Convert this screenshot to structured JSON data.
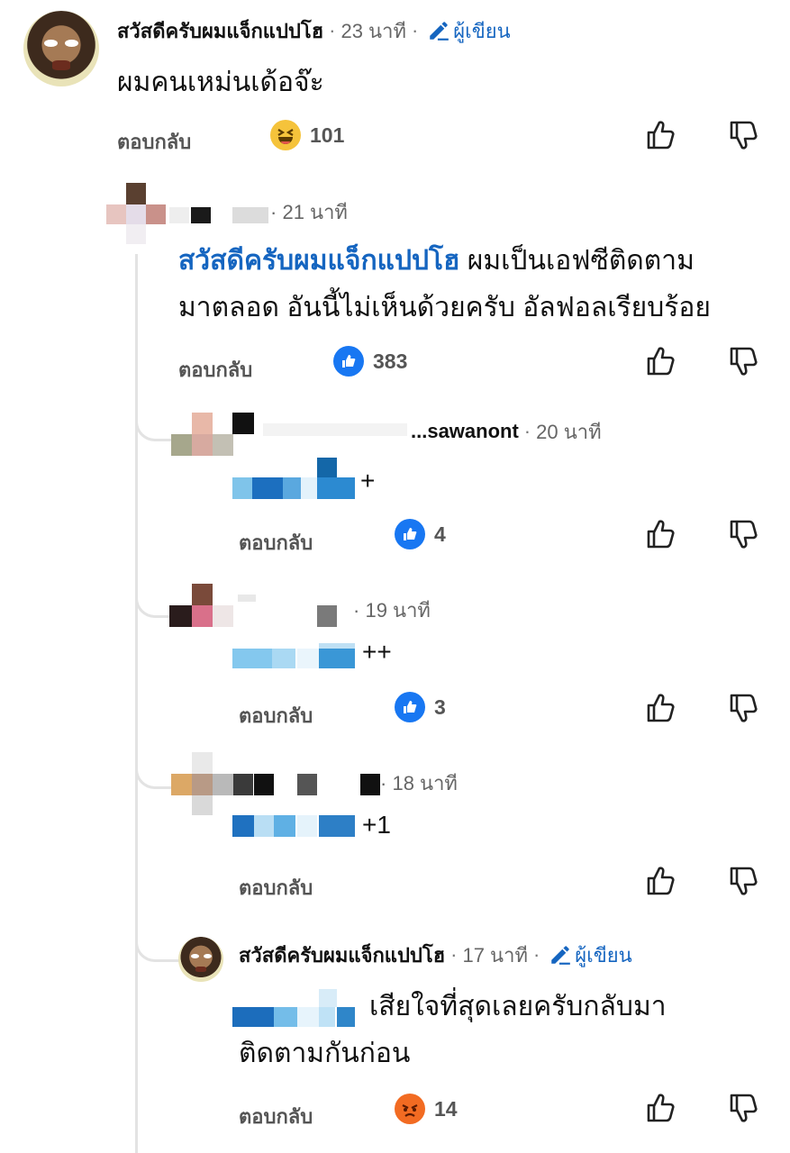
{
  "comments": [
    {
      "author": "สวัสดีครับผมแจ็กแปปโฮ",
      "time": "23 นาที",
      "author_badge": "ผู้เขียน",
      "text": "ผมคนเหม่นเด้อจ๊ะ",
      "reply_label": "ตอบกลับ",
      "reaction_icon": "laughing-emoji-icon",
      "reaction_count": "101"
    },
    {
      "time": "21 นาที",
      "mention": "สวัสดีครับผมแจ็กแปปโฮ",
      "text_line1": " ผมเป็นเอฟซีติดตาม",
      "text_line2": "มาตลอด อันนี้ไม่เห็นด้วยครับ อัลฟอลเรียบร้อย",
      "reply_label": "ตอบกลับ",
      "reaction_icon": "like-icon",
      "reaction_count": "383"
    },
    {
      "author_partial": "...sawanont",
      "time": "20 นาที",
      "text": "+",
      "reply_label": "ตอบกลับ",
      "reaction_icon": "like-icon",
      "reaction_count": "4"
    },
    {
      "time": "19 นาที",
      "text": "++",
      "reply_label": "ตอบกลับ",
      "reaction_icon": "like-icon",
      "reaction_count": "3"
    },
    {
      "time": "18 นาที",
      "text": "+1",
      "reply_label": "ตอบกลับ"
    },
    {
      "author": "สวัสดีครับผมแจ็กแปปโฮ",
      "time": "17 นาที",
      "author_badge": "ผู้เขียน",
      "text_line1": "เสียใจที่สุดเลยครับกลับมา",
      "text_line2": "ติดตามกันก่อน",
      "reply_label": "ตอบกลับ",
      "reaction_icon": "angry-emoji-icon",
      "reaction_count": "14"
    }
  ],
  "separator": "·",
  "colors": {
    "mention": "#1565c0",
    "like": "#1877f2",
    "angry": "#f26b22",
    "laugh": "#f5c33b"
  }
}
